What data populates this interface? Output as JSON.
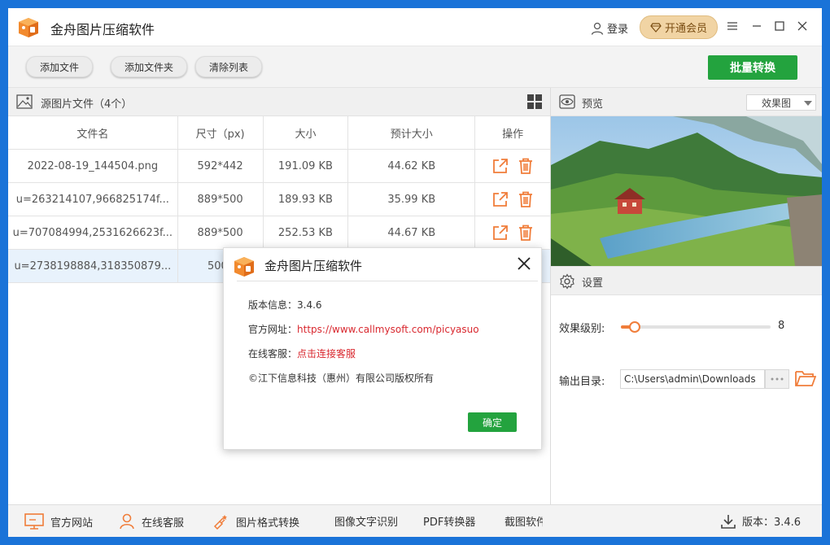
{
  "app": {
    "title": "金舟图片压缩软件"
  },
  "titlebar": {
    "login": "登录",
    "vip": "开通会员"
  },
  "toolbar": {
    "add_file": "添加文件",
    "add_folder": "添加文件夹",
    "clear_list": "清除列表",
    "batch": "批量转换"
  },
  "list": {
    "title": "源图片文件（4个）",
    "headers": [
      "文件名",
      "尺寸（px)",
      "大小",
      "预计大小",
      "操作"
    ],
    "rows": [
      {
        "name": "2022-08-19_144504.png",
        "size": "592*442",
        "filesize": "191.09 KB",
        "estimate": "44.62 KB"
      },
      {
        "name": "u=263214107,966825174f...",
        "size": "889*500",
        "filesize": "189.93 KB",
        "estimate": "35.99 KB"
      },
      {
        "name": "u=707084994,2531626623f...",
        "size": "889*500",
        "filesize": "252.53 KB",
        "estimate": "44.67 KB"
      },
      {
        "name": "u=2738198884,318350879...",
        "size": "500*",
        "filesize": "",
        "estimate": ""
      }
    ]
  },
  "preview": {
    "title": "预览",
    "mode": "效果图"
  },
  "settings": {
    "title": "设置",
    "effect_label": "效果级别:",
    "effect_value": "8",
    "effect_fraction": 0.08,
    "output_label": "输出目录:",
    "output_path": "C:\\Users\\admin\\Downloads"
  },
  "footer": {
    "official_site": "官方网站",
    "online_service": "在线客服",
    "format_convert": "图片格式转换",
    "ocr": "图像文字识别",
    "pdf": "PDF转换器",
    "screenshot": "截图软件",
    "version": "版本：3.4.6"
  },
  "dialog": {
    "title": "金舟图片压缩软件",
    "version_line": "版本信息：3.4.6",
    "site_label": "官方网址：",
    "site_url": "https://www.callmysoft.com/picyasuo",
    "service_label": "在线客服：",
    "service_link": "点击连接客服",
    "copyright": "©江下信息科技（惠州）有限公司版权所有",
    "ok": "确定"
  },
  "colors": {
    "accent_green": "#23a33e",
    "accent_orange": "#f07d3a",
    "link_red": "#d9282f",
    "vip_gold": "#f1d4a4"
  }
}
